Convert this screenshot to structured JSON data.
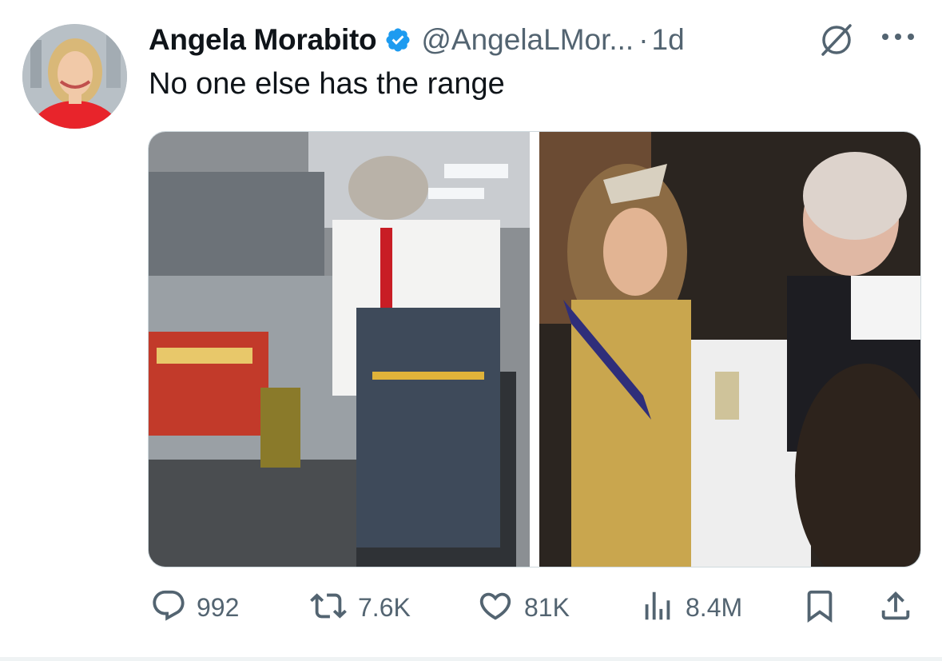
{
  "author": {
    "name": "Angela Morabito",
    "handle": "@AngelaLMor...",
    "separator": "·",
    "time": "1d",
    "verified": true
  },
  "tweet": {
    "text": "No one else has the range"
  },
  "header_icons": [
    "grok-icon",
    "more-icon"
  ],
  "media": [
    {
      "icon": "photo",
      "description_name": "fry-station-photo"
    },
    {
      "icon": "photo",
      "description_name": "state-banquet-photo"
    }
  ],
  "actions": {
    "reply": {
      "icon": "reply-icon",
      "count": "992"
    },
    "repost": {
      "icon": "repost-icon",
      "count": "7.6K"
    },
    "like": {
      "icon": "like-icon",
      "count": "81K"
    },
    "views": {
      "icon": "views-icon",
      "count": "8.4M"
    },
    "bookmark": {
      "icon": "bookmark-icon"
    },
    "share": {
      "icon": "share-icon"
    }
  },
  "colors": {
    "text_primary": "#0f1419",
    "text_secondary": "#536471",
    "verified_blue": "#1d9bf0",
    "border": "#cfd9de"
  }
}
